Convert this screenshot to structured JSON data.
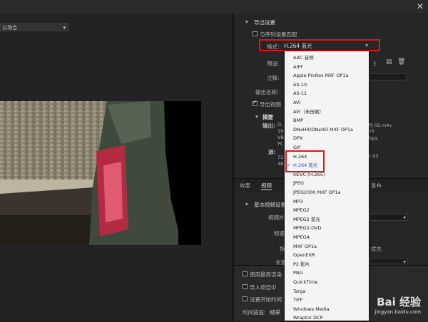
{
  "window": {
    "close_glyph": "✕"
  },
  "source": {
    "range_value": "以场合"
  },
  "export_settings": {
    "section_title": "导出设置",
    "match_sequence_label": "与序列设置匹配",
    "format_label": "格式:",
    "format_value": "H.264 蓝光",
    "preset_label": "预设:",
    "comment_label": "注释:",
    "output_name_label": "输出名称:",
    "export_video_label": "导出视频",
    "summary_title": "摘要",
    "summary_output_label": "输出:",
    "summary_source_label": "源:",
    "summary_output_lines": [
      "D:",
      "19",
      "VB",
      "PC"
    ],
    "summary_source_lines": [
      "72",
      "48"
    ],
    "summary_right_1": "列 02.m4v",
    "summary_right_2": "03",
    "summary_right_3": "lbps",
    "summary_right_4": "1:03"
  },
  "format_dropdown": {
    "options": [
      "AAC 音频",
      "AIFF",
      "Apple ProRes MXF OP1a",
      "AS-10",
      "AS-11",
      "AVI",
      "AVI（未压缩）",
      "BMP",
      "DNxHR/DNxHD MXF OP1a",
      "DPX",
      "GIF",
      "H.264",
      "H.264 蓝光",
      "HEVC (H.265)",
      "JPEG",
      "JPEG2000 MXF OP1a",
      "MP3",
      "MPEG2",
      "MPEG2 蓝光",
      "MPEG2-DVD",
      "MPEG4",
      "MXF OP1a",
      "OpenEXR",
      "P2 影片",
      "PNG",
      "QuickTime",
      "Targa",
      "TIFF",
      "Windows Media",
      "Wraptor DCP"
    ],
    "selected": "H.264 蓝光",
    "check_glyph": "✓"
  },
  "tabs": [
    "效果",
    "视频",
    "发布"
  ],
  "video_settings": {
    "section_title": "基本视频设置",
    "video_label_partial": "视频片",
    "frame_label_partial": "帧速",
    "field_label_partial": "场",
    "aspect_label_partial": "长宽",
    "right_text_partial": "优先"
  },
  "bottom_options": {
    "max_render_label": "使用最高渲染",
    "import_label": "导入项目中",
    "set_start_label": "设置开始时间",
    "time_interp_label": "时间插值:",
    "time_interp_value": "帧采"
  },
  "watermark": {
    "brand": "Bai 经验",
    "url": "jingyan.baidu.com"
  },
  "colors": {
    "highlight_red": "#e2141b",
    "selected_blue": "#1a55c7"
  }
}
